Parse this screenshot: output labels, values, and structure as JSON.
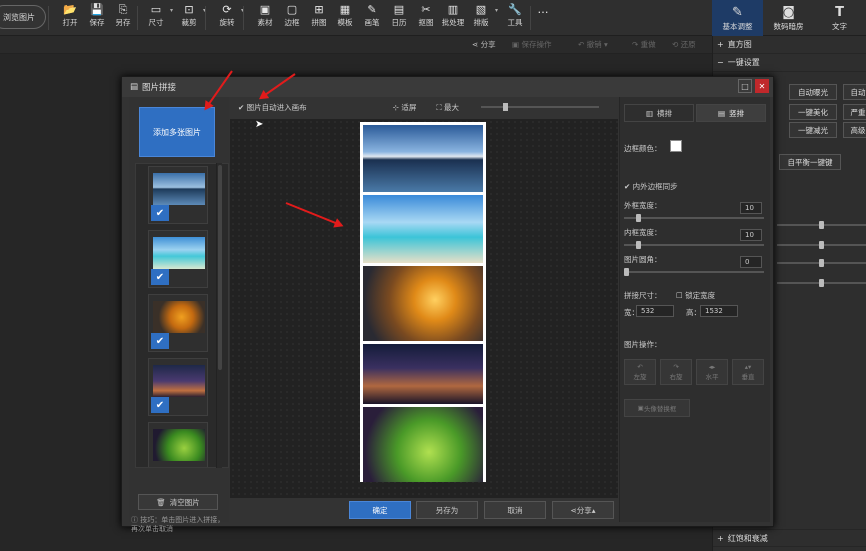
{
  "toolbar": {
    "browse": "浏览图片",
    "tools": [
      "打开",
      "保存",
      "另存",
      "尺寸",
      "裁剪",
      "旋转",
      "素材",
      "边框",
      "拼图",
      "模板",
      "画笔",
      "日历",
      "抠图",
      "批处理",
      "排版",
      "工具"
    ],
    "more": "…"
  },
  "right_tabs": [
    "基本调整",
    "数码暗房",
    "文字"
  ],
  "subbar": {
    "share": "分享",
    "save_op": "保存操作",
    "undo": "撤销",
    "redo": "重做",
    "restore": "还原"
  },
  "right_panel": {
    "histogram": "直方图",
    "oneclick": "一键设置",
    "buttons": [
      "自动曝光",
      "自动",
      "一键美化",
      "严重",
      "一键减光",
      "高级",
      "自平衡一键键"
    ],
    "bottom": "红饱和衰减"
  },
  "dialog": {
    "title": "图片拼接",
    "add_btn": "添加多张图片",
    "auto_fill": "图片自动进入画布",
    "fit": "适屏",
    "maximize": "最大",
    "clear_btn": "清空图片",
    "tip": "技巧：单击图片进入拼接，再次单击取消",
    "ok": "确定",
    "save_as": "另存为",
    "cancel": "取消",
    "share": "分享"
  },
  "settings": {
    "tab_horizontal": "横排",
    "tab_vertical": "竖排",
    "border_color": "边框颜色：",
    "sync": "内外边框同步",
    "outer": "外框宽度：",
    "outer_val": "10",
    "inner": "内框宽度：",
    "inner_val": "10",
    "corner": "图片圆角：",
    "corner_val": "0",
    "size": "拼接尺寸：",
    "lock": "锁定宽度",
    "width_lbl": "宽：",
    "width": "532",
    "height_lbl": "高：",
    "height": "1532",
    "ops": "图片操作：",
    "op_btns": [
      "左旋",
      "右旋",
      "水平",
      "垂直"
    ],
    "replace": "头像替换框"
  },
  "colors": {
    "accent": "#2f6fc2",
    "arrow": "#e21b1b",
    "close": "#c0282b"
  }
}
